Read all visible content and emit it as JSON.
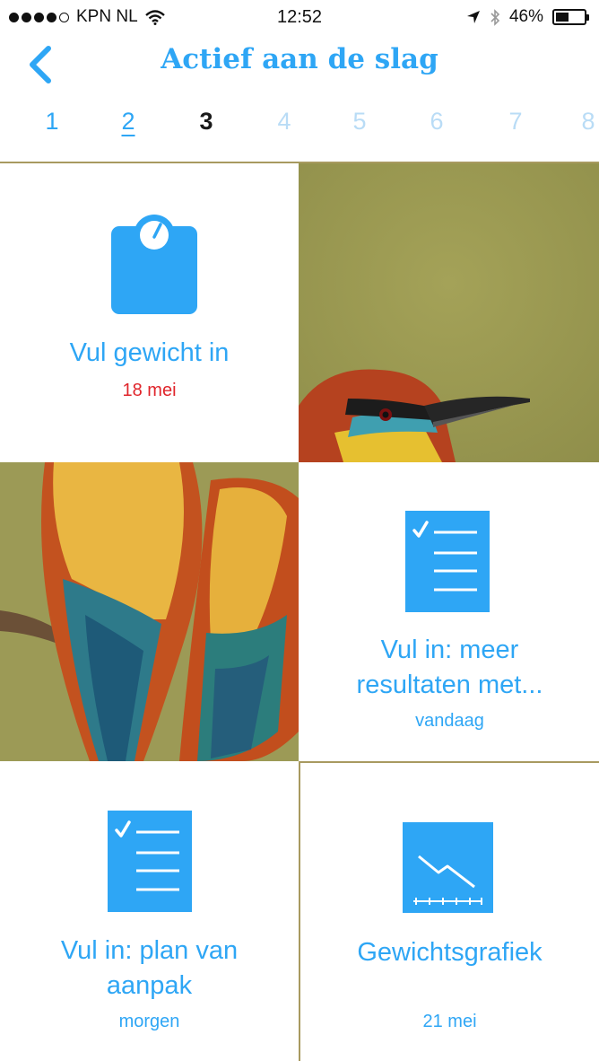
{
  "status_bar": {
    "carrier": "KPN NL",
    "time": "12:52",
    "battery": "46%",
    "battery_level": 0.46
  },
  "nav": {
    "back_icon": "chevron-left-icon",
    "title": "Actief aan de slag"
  },
  "weeks": {
    "items": [
      "1",
      "2",
      "3",
      "4",
      "5",
      "6",
      "7",
      "8"
    ],
    "active": "3",
    "underlined": "2"
  },
  "tiles": {
    "weight": {
      "icon": "scale-icon",
      "label": "Vul gewicht in",
      "sub": "18 mei"
    },
    "results": {
      "icon": "checklist-icon",
      "label_line1": "Vul in: meer",
      "label_line2": "resultaten met...",
      "sub": "vandaag"
    },
    "plan": {
      "icon": "checklist-icon",
      "label_line1": "Vul in: plan van",
      "label_line2": "aanpak",
      "sub": "morgen"
    },
    "graph": {
      "icon": "line-graph-icon",
      "label": "Gewichtsgrafiek",
      "sub": "21 mei"
    }
  },
  "colors": {
    "accent": "#2ea6f5",
    "date_red": "#e0252b",
    "divider": "#a89a60",
    "photo_bg": "#9c9a56"
  }
}
